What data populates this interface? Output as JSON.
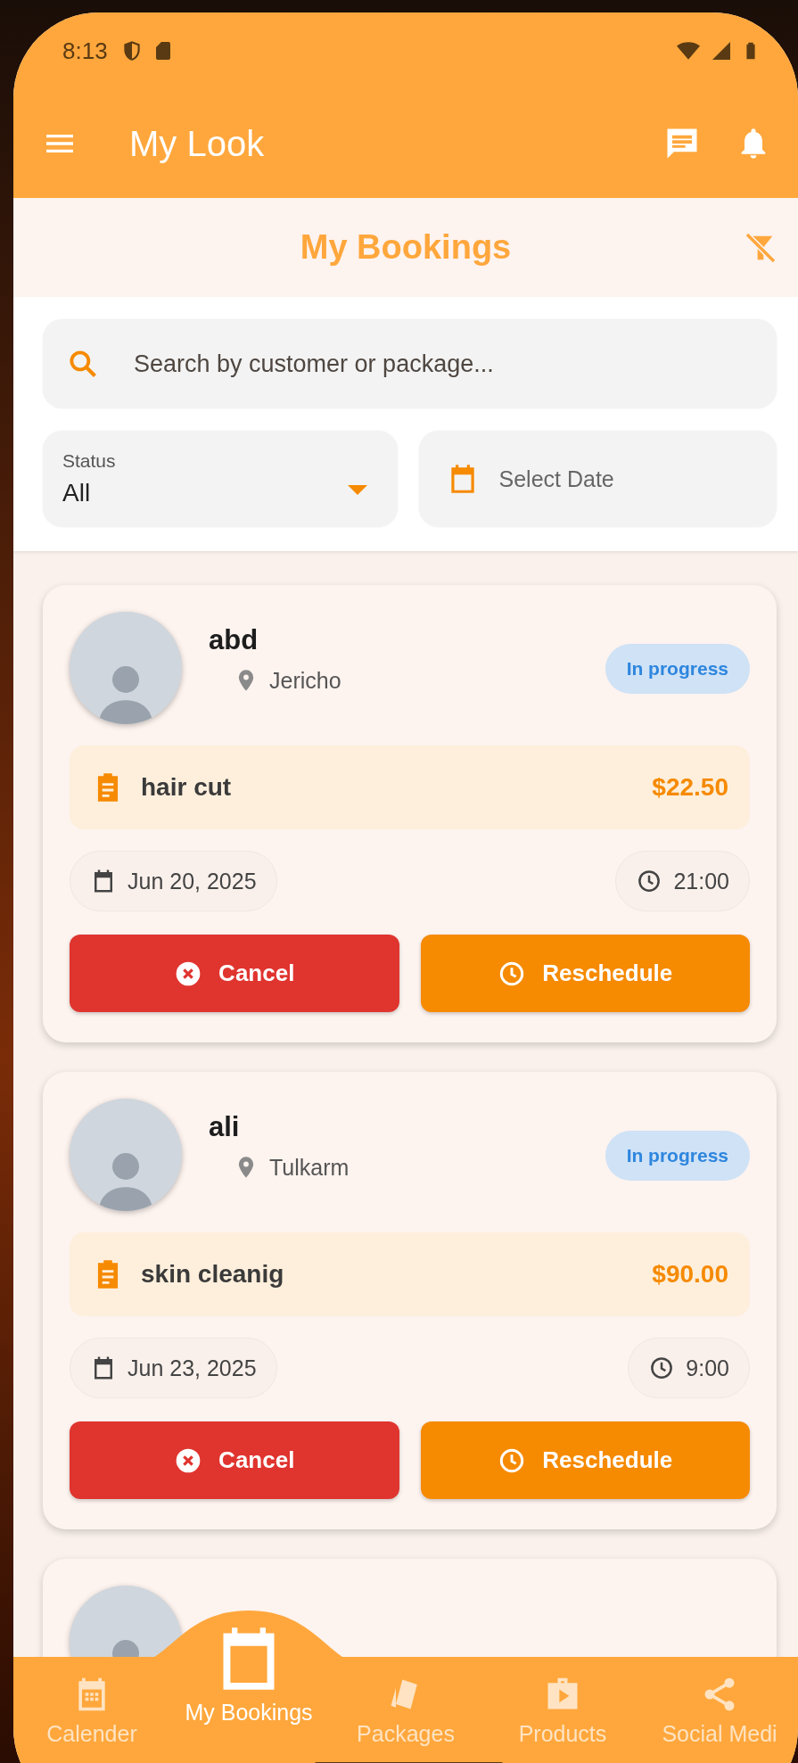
{
  "status_bar": {
    "time": "8:13"
  },
  "app_bar": {
    "title": "My Look"
  },
  "header": {
    "title": "My Bookings"
  },
  "search": {
    "placeholder": "Search by customer or package..."
  },
  "status_filter": {
    "label": "Status",
    "value": "All"
  },
  "date_filter": {
    "placeholder": "Select Date"
  },
  "bookings": [
    {
      "name": "abd",
      "location": "Jericho",
      "status": "In progress",
      "package": "hair cut",
      "price": "$22.50",
      "date": "Jun 20, 2025",
      "time": "21:00",
      "actions": [
        {
          "label": "Cancel",
          "kind": "cancel"
        },
        {
          "label": "Reschedule",
          "kind": "reschedule"
        }
      ]
    },
    {
      "name": "ali",
      "location": "Tulkarm",
      "status": "In progress",
      "package": "skin cleanig",
      "price": "$90.00",
      "date": "Jun 23, 2025",
      "time": "9:00",
      "actions": [
        {
          "label": "Cancel",
          "kind": "cancel"
        },
        {
          "label": "Reschedule",
          "kind": "reschedule"
        }
      ]
    }
  ],
  "bottom_nav": [
    {
      "label": "Calender",
      "kind": "calendar",
      "selected": false
    },
    {
      "label": "My Bookings",
      "kind": "bookings",
      "selected": true
    },
    {
      "label": "Packages",
      "kind": "packages",
      "selected": false
    },
    {
      "label": "Products",
      "kind": "products",
      "selected": false
    },
    {
      "label": "Social Medi",
      "kind": "share",
      "selected": false
    }
  ]
}
